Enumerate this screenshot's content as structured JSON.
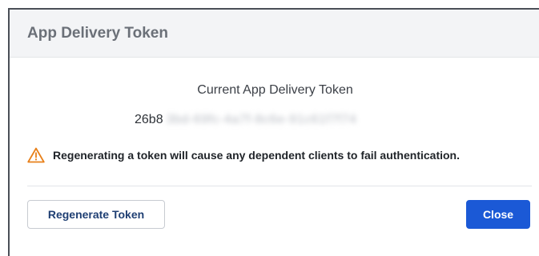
{
  "dialog": {
    "title": "App Delivery Token",
    "token_label": "Current App Delivery Token",
    "token_visible": "26b8",
    "token_obscured": "3bd-69fc-4a7f-8c6e-91c61f7f74",
    "warning_icon": "warning-triangle-icon",
    "warning_text": "Regenerating a token will cause any dependent clients to fail authentication.",
    "regenerate_label": "Regenerate Token",
    "close_label": "Close"
  },
  "colors": {
    "accent": "#1b59d6",
    "warning": "#e8801a",
    "header_bg": "#f3f4f6"
  }
}
